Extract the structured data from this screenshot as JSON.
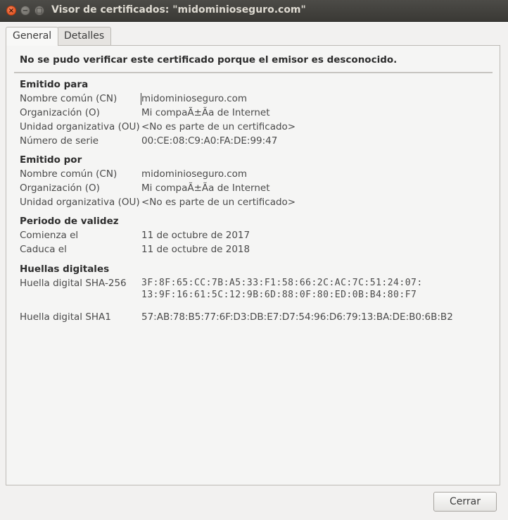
{
  "window": {
    "title": "Visor de certificados: \"midominioseguro.com\"",
    "close_glyph": "×",
    "minimize_glyph": "−",
    "maximize_glyph": "□"
  },
  "tabs": [
    {
      "label": "General",
      "active": true
    },
    {
      "label": "Detalles",
      "active": false
    }
  ],
  "warning": "No se pudo verificar este certificado porque el emisor es desconocido.",
  "issued_to": {
    "heading": "Emitido para",
    "rows": [
      {
        "label": "Nombre común (CN)",
        "value": "midominioseguro.com"
      },
      {
        "label": "Organización (O)",
        "value": "Mi compaÃ±Ãa de Internet"
      },
      {
        "label": "Unidad organizativa (OU)",
        "value": "<No es parte de un certificado>"
      },
      {
        "label": "Número de serie",
        "value": "00:CE:08:C9:A0:FA:DE:99:47"
      }
    ]
  },
  "issued_by": {
    "heading": "Emitido por",
    "rows": [
      {
        "label": "Nombre común (CN)",
        "value": "midominioseguro.com"
      },
      {
        "label": "Organización (O)",
        "value": "Mi compaÃ±Ãa de Internet"
      },
      {
        "label": "Unidad organizativa (OU)",
        "value": "<No es parte de un certificado>"
      }
    ]
  },
  "validity": {
    "heading": "Periodo de validez",
    "rows": [
      {
        "label": "Comienza el",
        "value": "11 de octubre de 2017"
      },
      {
        "label": "Caduca el",
        "value": "11 de octubre de 2018"
      }
    ]
  },
  "fingerprints": {
    "heading": "Huellas digitales",
    "sha256_label": "Huella digital SHA-256",
    "sha256_line1": "3F:8F:65:CC:7B:A5:33:F1:58:66:2C:AC:7C:51:24:07:",
    "sha256_line2": "13:9F:16:61:5C:12:9B:6D:88:0F:80:ED:0B:B4:80:F7",
    "sha1_label": "Huella digital SHA1",
    "sha1_value": "57:AB:78:B5:77:6F:D3:DB:E7:D7:54:96:D6:79:13:BA:DE:B0:6B:B2"
  },
  "buttons": {
    "close_label": "Cerrar"
  }
}
